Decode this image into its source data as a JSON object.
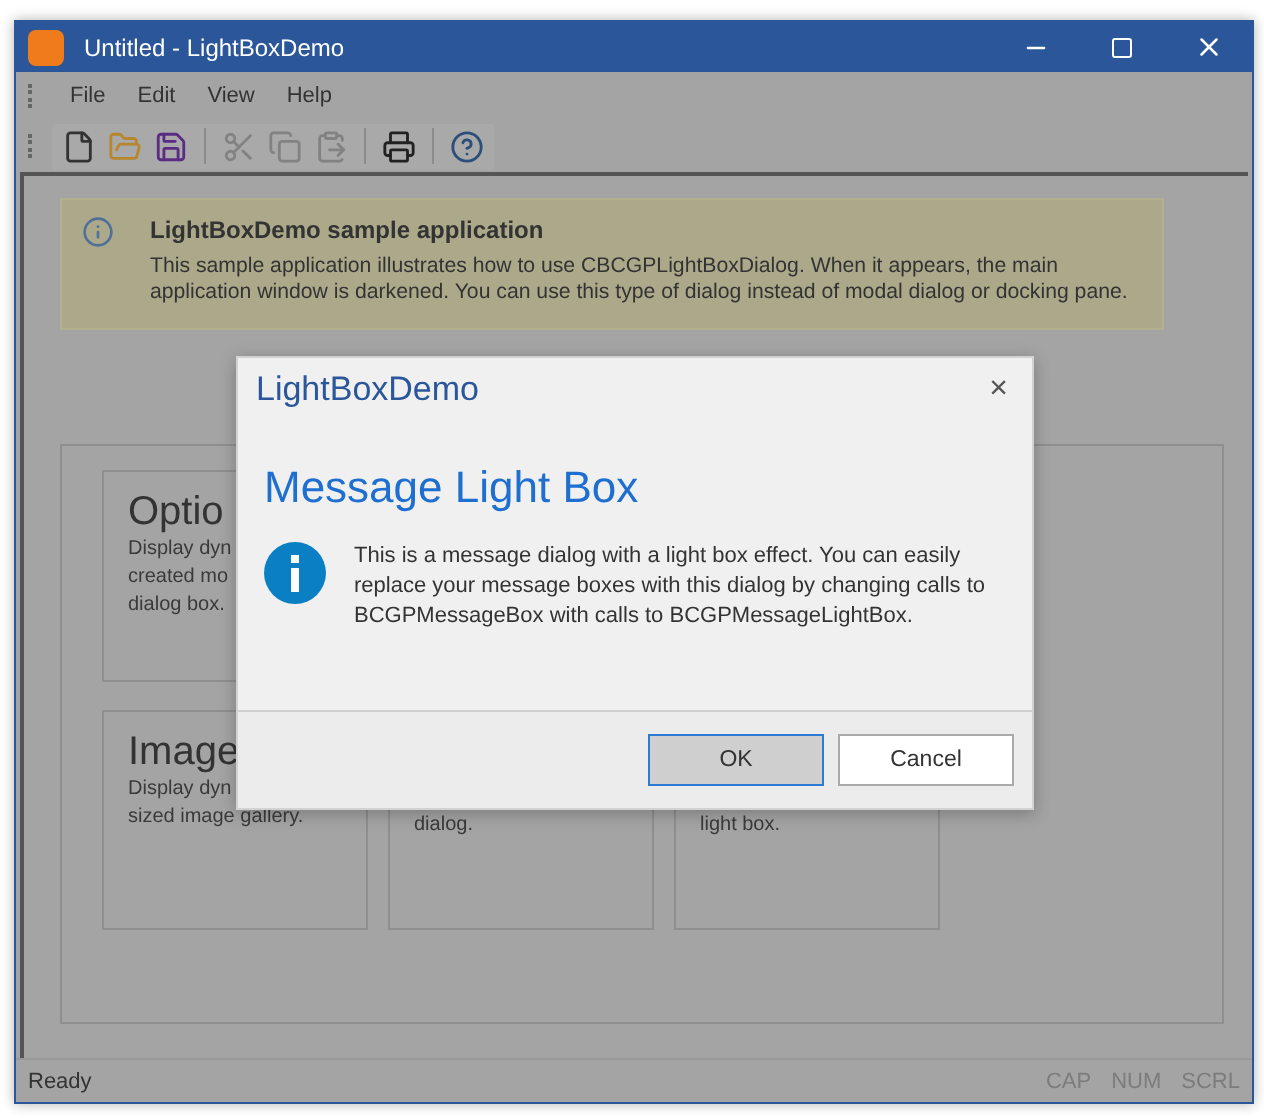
{
  "window": {
    "title": "Untitled - LightBoxDemo"
  },
  "menu": [
    "File",
    "Edit",
    "View",
    "Help"
  ],
  "toolbar": [
    {
      "kind": "new",
      "disabled": false
    },
    {
      "kind": "open",
      "disabled": false
    },
    {
      "kind": "save",
      "disabled": false
    },
    {
      "kind": "cut",
      "disabled": true
    },
    {
      "kind": "copy",
      "disabled": true
    },
    {
      "kind": "paste",
      "disabled": true
    },
    {
      "kind": "print",
      "disabled": false
    },
    {
      "kind": "help",
      "disabled": false
    }
  ],
  "info": {
    "title": "LightBoxDemo sample application",
    "text": "This sample application illustrates how to use CBCGPLightBoxDialog. When it appears, the main application window is darkened. You can use this type of dialog instead of modal dialog or docking pane."
  },
  "tiles": [
    {
      "title": "Optio",
      "lines": [
        "Display dyn",
        "created mo",
        "dialog box."
      ]
    },
    {
      "title": "Image",
      "lines": [
        "Display dyn",
        "sized image gallery."
      ]
    },
    {
      "lines": [
        "dialog."
      ]
    },
    {
      "lines": [
        "light box."
      ]
    }
  ],
  "dialog": {
    "title": "LightBoxDemo",
    "close": "×",
    "heading": "Message Light Box",
    "message": "This is a message dialog with a light box effect. You can easily replace your message boxes with this dialog by changing calls to BCGPMessageBox with calls to BCGPMessageLightBox.",
    "buttons": [
      {
        "label": "OK",
        "selected": true
      },
      {
        "label": "Cancel",
        "selected": false
      }
    ]
  },
  "status_bar": {
    "text": "Ready",
    "indicators": [
      "CAP",
      "NUM",
      "SCRL"
    ]
  }
}
